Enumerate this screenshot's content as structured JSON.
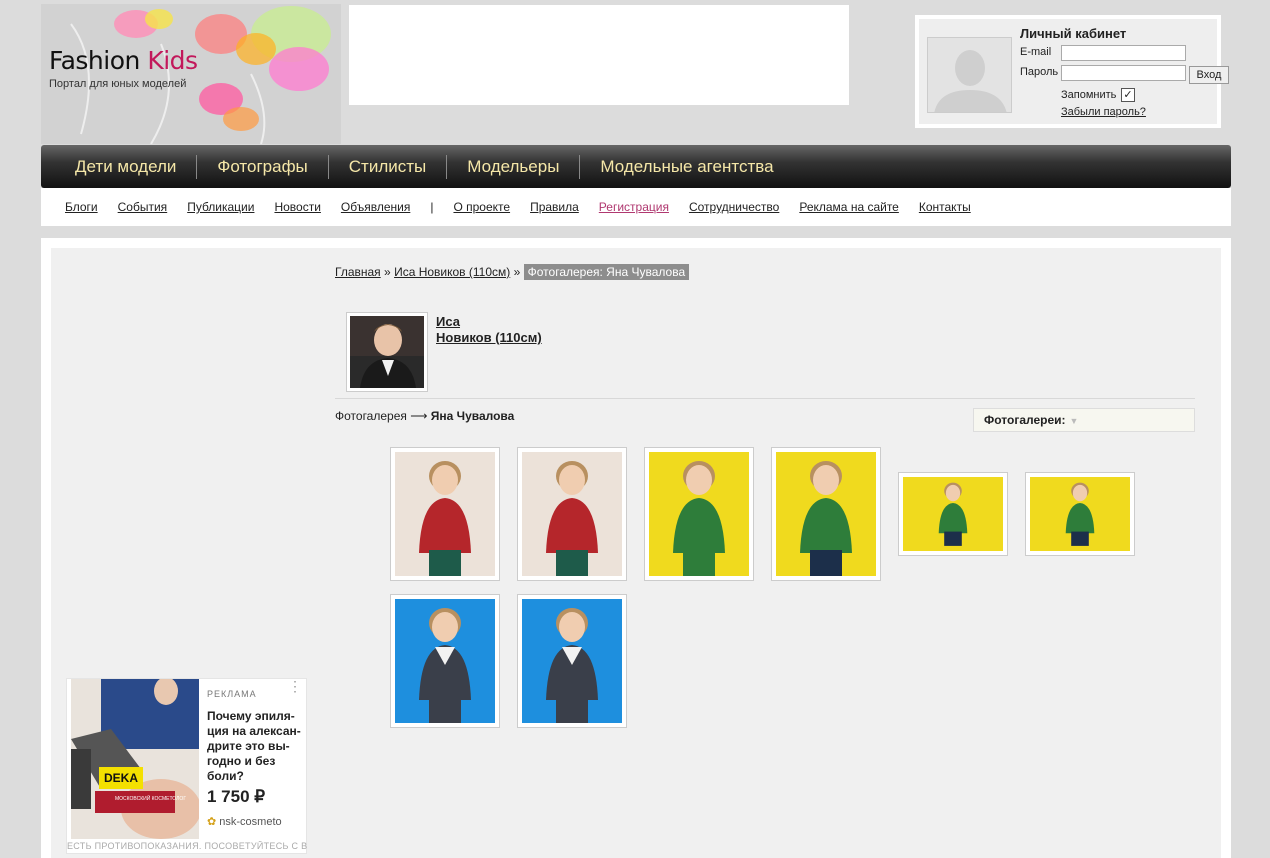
{
  "logo": {
    "name_part1": "Fashion ",
    "name_part2": "Kids",
    "subtitle": "Портал для юных моделей"
  },
  "login": {
    "title": "Личный кабинет",
    "email_label": "E-mail",
    "password_label": "Пароль",
    "submit_label": "Вход",
    "remember_label": "Запомнить",
    "remember_checked": "✓",
    "forgot_label": "Забыли пароль?"
  },
  "main_nav": [
    "Дети модели",
    "Фотографы",
    "Стилисты",
    "Модельеры",
    "Модельные агентства"
  ],
  "sub_nav": {
    "left": [
      "Блоги",
      "События",
      "Публикации",
      "Новости",
      "Объявления"
    ],
    "separator": "|",
    "right": [
      "О проекте",
      "Правила",
      "Регистрация",
      "Сотрудничество",
      "Реклама на сайте",
      "Контакты"
    ]
  },
  "breadcrumb": {
    "home": "Главная",
    "sep": "»",
    "profile": "Иса Новиков (110см)",
    "current": "Фотогалерея: Яна Чувалова"
  },
  "profile": {
    "first_name": "Иса",
    "last_name": "Новиков (110см)"
  },
  "gallery": {
    "path_prefix": "Фотогалерея ⟶ ",
    "photographer": "Яна Чувалова",
    "dropdown_label": "Фотогалереи:",
    "photos": [
      {
        "bg": "#ece2d9",
        "shirt": "#b5262b",
        "pants": "#1e5b4a",
        "orientation": "portrait"
      },
      {
        "bg": "#ece2d9",
        "shirt": "#b5262b",
        "pants": "#1e5b4a",
        "orientation": "portrait"
      },
      {
        "bg": "#f0da1e",
        "shirt": "#2e7d3a",
        "pants": "#2e7d3a",
        "orientation": "portrait"
      },
      {
        "bg": "#f0da1e",
        "shirt": "#2e7d3a",
        "pants": "#1c2f4a",
        "orientation": "portrait"
      },
      {
        "bg": "#f0da1e",
        "shirt": "#2e7d3a",
        "pants": "#1c2f4a",
        "orientation": "landscape"
      },
      {
        "bg": "#f0da1e",
        "shirt": "#2e7d3a",
        "pants": "#1c2f4a",
        "orientation": "landscape"
      },
      {
        "bg": "#1e8fde",
        "shirt": "#3a3f4a",
        "pants": "#3a3f4a",
        "orientation": "portrait"
      },
      {
        "bg": "#1e8fde",
        "shirt": "#3a3f4a",
        "pants": "#3a3f4a",
        "orientation": "portrait"
      }
    ]
  },
  "ad": {
    "label": "РЕКЛАМА",
    "dots": "⋮",
    "text": "Почему эпиля-ция на алексан-дрите это вы-годно и без боли?",
    "price": "1 750 ₽",
    "site": "nsk-cosmeto",
    "brand1": "DEKA",
    "brand2": "МОСКОВСКИЙ КОСМЕТОЛОГ",
    "disclaimer": "ЕСТЬ ПРОТИВОПОКАЗАНИЯ. ПОСОВЕТУЙТЕСЬ С ВРАЧОМ"
  }
}
